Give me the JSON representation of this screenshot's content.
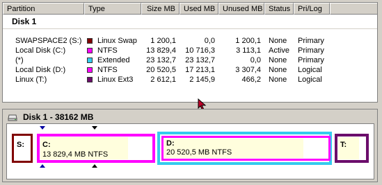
{
  "columns": [
    "Partition",
    "Type",
    "Size MB",
    "Used MB",
    "Unused MB",
    "Status",
    "Pri/Log"
  ],
  "disk_label": "Disk 1",
  "rows": [
    {
      "partition": "SWAPSPACE2 (S:)",
      "type": "Linux Swap",
      "color": "#800000",
      "size": "1 200,1",
      "used": "0,0",
      "unused": "1 200,1",
      "status": "None",
      "prilog": "Primary"
    },
    {
      "partition": "Local Disk (C:)",
      "type": "NTFS",
      "color": "#ff00ff",
      "size": "13 829,4",
      "used": "10 716,3",
      "unused": "3 113,1",
      "status": "Active",
      "prilog": "Primary"
    },
    {
      "partition": "(*)",
      "type": "Extended",
      "color": "#33ccee",
      "size": "23 132,7",
      "used": "23 132,7",
      "unused": "0,0",
      "status": "None",
      "prilog": "Primary"
    },
    {
      "partition": "Local Disk (D:)",
      "type": "NTFS",
      "color": "#ff00ff",
      "size": "20 520,5",
      "used": "17 213,1",
      "unused": "3 307,4",
      "status": "None",
      "prilog": "Logical"
    },
    {
      "partition": "Linux (T:)",
      "type": "Linux Ext3",
      "color": "#6b0d6b",
      "size": "2 612,1",
      "used": "2 145,9",
      "unused": "466,2",
      "status": "None",
      "prilog": "Logical"
    }
  ],
  "map": {
    "title": "Disk 1 - 38162 MB",
    "icon": "disk-drive-icon",
    "blocks": [
      {
        "letter": "S:",
        "detail": "",
        "color": "#800000"
      },
      {
        "letter": "C:",
        "detail": "13 829,4 MB    NTFS",
        "color": "#ff00ff"
      },
      {
        "letter": "D:",
        "detail": "20 520,5 MB    NTFS",
        "color": "#ff00ff",
        "container_color": "#33ccee"
      },
      {
        "letter": "T:",
        "detail": "",
        "color": "#6b0d6b"
      }
    ]
  }
}
